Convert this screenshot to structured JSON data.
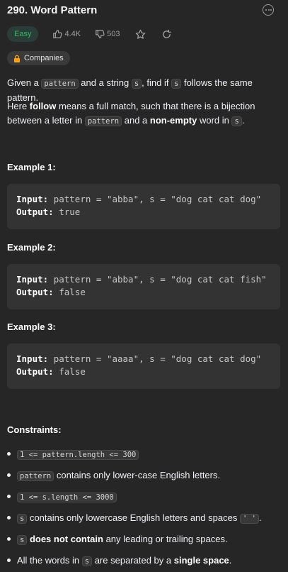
{
  "header": {
    "title": "290. Word Pattern"
  },
  "meta": {
    "difficulty": "Easy",
    "likes": "4.4K",
    "dislikes": "503"
  },
  "tags": {
    "companies": "Companies"
  },
  "description": {
    "p1": {
      "t1": "Given a ",
      "c1": "pattern",
      "t2": " and a string ",
      "c2": "s",
      "t3": ", find if ",
      "c3": "s",
      "t4": " follows the same pattern."
    },
    "p2": {
      "t1": "Here ",
      "b1": "follow",
      "t2": " means a full match, such that there is a bijection between a letter in ",
      "c1": "pattern",
      "t3": " and a ",
      "b2": "non-empty",
      "t4": " word in ",
      "c2": "s",
      "t5": "."
    }
  },
  "examples": [
    {
      "heading": "Example 1:",
      "input_label": "Input:",
      "input": "pattern = \"abba\", s = \"dog cat cat dog\"",
      "output_label": "Output:",
      "output": "true"
    },
    {
      "heading": "Example 2:",
      "input_label": "Input:",
      "input": "pattern = \"abba\", s = \"dog cat cat fish\"",
      "output_label": "Output:",
      "output": "false"
    },
    {
      "heading": "Example 3:",
      "input_label": "Input:",
      "input": "pattern = \"aaaa\", s = \"dog cat cat dog\"",
      "output_label": "Output:",
      "output": "false"
    }
  ],
  "constraints": {
    "heading": "Constraints:",
    "c1": "1 <= pattern.length <= 300",
    "c2": {
      "code": "pattern",
      "text": " contains only lower-case English letters."
    },
    "c3": "1 <= s.length <= 3000",
    "c4": {
      "code": "s",
      "text": " contains only lowercase English letters and spaces ",
      "code2": "' '",
      "end": "."
    },
    "c5": {
      "code": "s",
      "bold": " does not contain",
      "text": " any leading or trailing spaces."
    },
    "c6": {
      "t1": "All the words in ",
      "code": "s",
      "t2": " are separated by a ",
      "bold": "single space",
      "end": "."
    }
  },
  "colors": {
    "background": "#262626",
    "easy": "#2cbb5d",
    "code_bg": "#383838",
    "example_bg": "#333333"
  }
}
